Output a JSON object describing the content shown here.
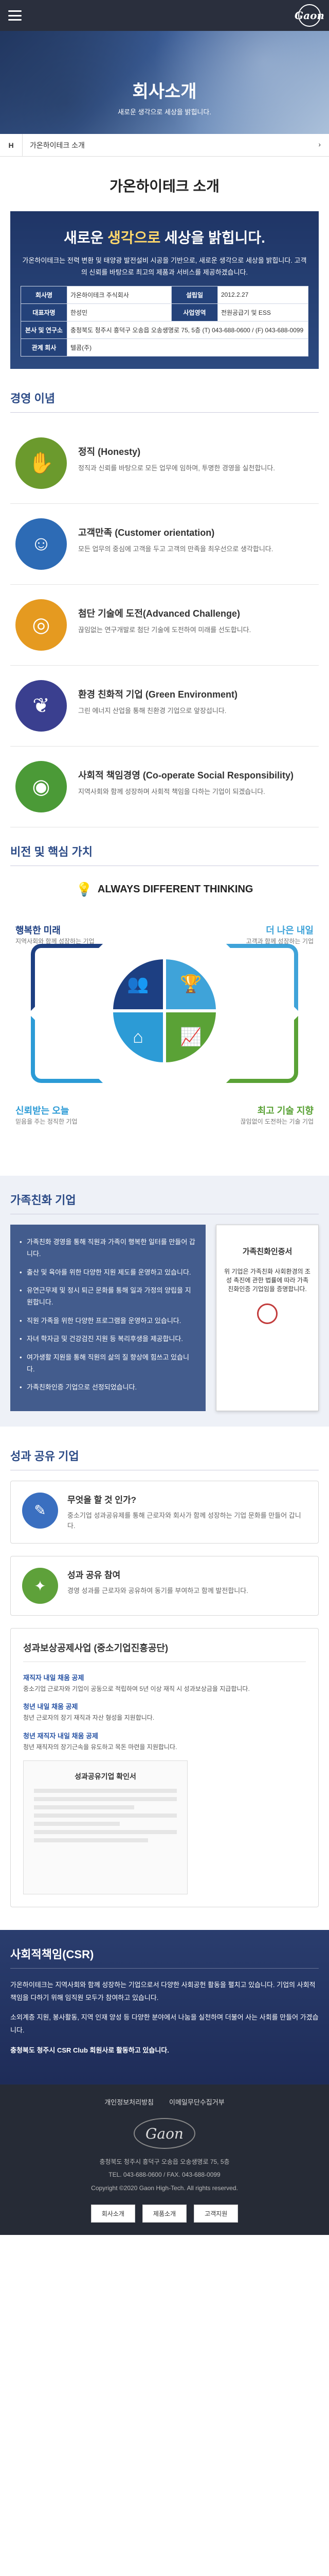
{
  "header": {
    "logo": "Gaon"
  },
  "hero": {
    "title": "회사소개",
    "subtitle": "새로운 생각으로 세상을 밝힙니다."
  },
  "breadcrumb": {
    "home": "H",
    "current": "가온하이테크 소개",
    "arrow": "›"
  },
  "page_title": "가온하이테크 소개",
  "intro": {
    "headline_a": "새로운 ",
    "headline_hl": "생각으로",
    "headline_b": " 세상을 밝힙니다.",
    "body": "가온하이테크는 전력 변환 및 태양광 발전설비 시공을 기반으로, 새로운 생각으로 세상을 밝힙니다. 고객의 신뢰를 바탕으로 최고의 제품과 서비스를 제공하겠습니다.",
    "table": [
      {
        "l1": "회사명",
        "v1": "가온하이테크 주식회사",
        "l2": "설립일",
        "v2": "2012.2.27"
      },
      {
        "l1": "대표자명",
        "v1": "한성민",
        "l2": "사업영역",
        "v2": "전원공급기 및 ESS"
      },
      {
        "l1": "본사 및 연구소",
        "v1": "충청북도 청주시 흥덕구 오송읍 오송생명로 75, 5층 (T) 043-688-0600 / (F) 043-688-0099",
        "l2": "",
        "v2": ""
      },
      {
        "l1": "관계 회사",
        "v1": "텔콤(주)",
        "l2": "",
        "v2": ""
      }
    ]
  },
  "values": {
    "title": "경영 이념",
    "items": [
      {
        "title": "정직 (Honesty)",
        "desc": "정직과 신뢰를 바탕으로 모든 업무에 임하며, 투명한 경영을 실천합니다.",
        "color": "#6b9a2d",
        "icon": "handshake-icon"
      },
      {
        "title": "고객만족 (Customer orientation)",
        "desc": "모든 업무의 중심에 고객을 두고 고객의 만족을 최우선으로 생각합니다.",
        "color": "#2d6bb5",
        "icon": "customer-icon"
      },
      {
        "title": "첨단 기술에 도전(Advanced Challenge)",
        "desc": "끊임없는 연구개발로 첨단 기술에 도전하여 미래를 선도합니다.",
        "color": "#e59a20",
        "icon": "target-icon"
      },
      {
        "title": "환경 친화적 기업 (Green Environment)",
        "desc": "그린 에너지 산업을 통해 친환경 기업으로 앞장섭니다.",
        "color": "#3a3f8f",
        "icon": "leaf-icon"
      },
      {
        "title": "사회적 책임경영 (Co-operate Social Responsibility)",
        "desc": "지역사회와 함께 성장하며 사회적 책임을 다하는 기업이 되겠습니다.",
        "color": "#4b9a37",
        "icon": "globe-icon"
      }
    ]
  },
  "vision": {
    "title": "비전 및 핵심 가치",
    "header": "ALWAYS DIFFERENT THINKING",
    "q1_title": "행복한 미래",
    "q1_sub": "지역사회와 함께 성장하는 기업",
    "q2_title": "더 나은 내일",
    "q2_sub": "고객과 함께 성장하는 기업",
    "q3_title": "신뢰받는 오늘",
    "q3_sub": "믿음을 주는 정직한 기업",
    "q4_title": "최고 기술 지향",
    "q4_sub": "끊임없이 도전하는 기술 기업"
  },
  "family": {
    "title": "가족친화 기업",
    "items": [
      "가족친화 경영을 통해 직원과 가족이 행복한 일터를 만들어 갑니다.",
      "출산 및 육아를 위한 다양한 지원 제도를 운영하고 있습니다.",
      "유연근무제 및 정시 퇴근 문화를 통해 일과 가정의 양립을 지원합니다.",
      "직원 가족을 위한 다양한 프로그램을 운영하고 있습니다.",
      "자녀 학자금 및 건강검진 지원 등 복리후생을 제공합니다.",
      "여가생활 지원을 통해 직원의 삶의 질 향상에 힘쓰고 있습니다.",
      "가족친화인증 기업으로 선정되었습니다."
    ],
    "cert_title": "가족친화인증서",
    "cert_body": "위 기업은 가족친화 사회환경의 조성 촉진에 관한 법률에 따라 가족친화인증 기업임을 증명합니다."
  },
  "share": {
    "title": "성과 공유 기업",
    "cards": [
      {
        "title": "무엇을 할 것 인가?",
        "desc": "중소기업 성과공유제를 통해 근로자와 회사가 함께 성장하는 기업 문화를 만들어 갑니다.",
        "color": "#3a6fc0",
        "icon": "chat-icon"
      },
      {
        "title": "성과 공유 참여",
        "desc": "경영 성과를 근로자와 공유하여 동기를 부여하고 함께 발전합니다.",
        "color": "#5ea13a",
        "icon": "people-icon"
      }
    ],
    "box_title": "성과보상공제사업 (중소기업진흥공단)",
    "box_items": [
      {
        "h": "재직자 내일 채움 공제",
        "p": "중소기업 근로자와 기업이 공동으로 적립하여 5년 이상 재직 시 성과보상금을 지급합니다."
      },
      {
        "h": "청년 내일 채움 공제",
        "p": "청년 근로자의 장기 재직과 자산 형성을 지원합니다."
      },
      {
        "h": "청년 재직자 내일 채움 공제",
        "p": "청년 재직자의 장기근속을 유도하고 목돈 마련을 지원합니다."
      }
    ],
    "doc_title": "성과공유기업 확인서"
  },
  "csr": {
    "title": "사회적책임(CSR)",
    "p1": "가온하이테크는 지역사회와 함께 성장하는 기업으로서 다양한 사회공헌 활동을 펼치고 있습니다. 기업의 사회적 책임을 다하기 위해 임직원 모두가 참여하고 있습니다.",
    "p2": "소외계층 지원, 봉사활동, 지역 인재 양성 등 다양한 분야에서 나눔을 실천하며 더불어 사는 사회를 만들어 가겠습니다.",
    "p3": "충청북도 청주시 CSR Club 회원사로 활동하고 있습니다."
  },
  "footer": {
    "nav": [
      "개인정보처리방침",
      "이메일무단수집거부"
    ],
    "logo": "Gaon",
    "address": "충청북도 청주시 흥덕구 오송읍 오송생명로 75, 5층",
    "contact": "TEL. 043-688-0600 / FAX. 043-688-0099",
    "copyright": "Copyright ©2020 Gaon High-Tech. All rights reserved.",
    "btn1": "회사소개",
    "btn2": "제품소개",
    "btn3": "고객지원"
  }
}
